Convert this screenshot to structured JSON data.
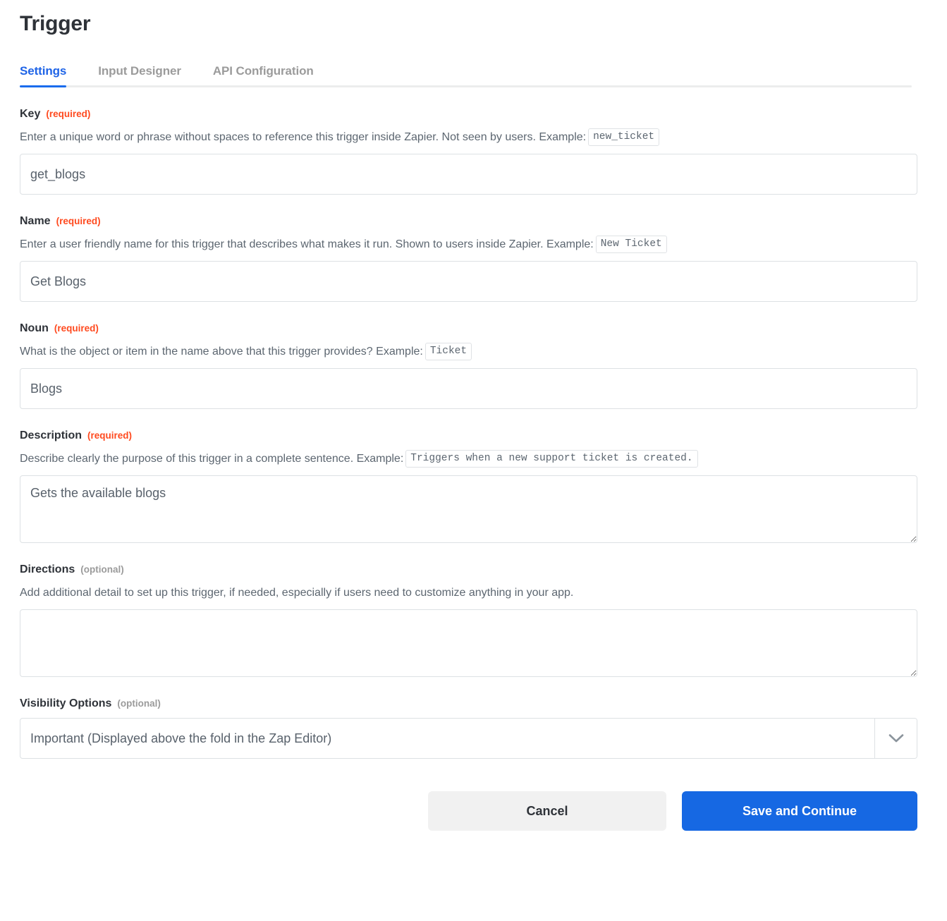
{
  "page": {
    "title": "Trigger"
  },
  "tabs": [
    {
      "label": "Settings",
      "active": true
    },
    {
      "label": "Input Designer",
      "active": false
    },
    {
      "label": "API Configuration",
      "active": false
    }
  ],
  "fields": {
    "key": {
      "label": "Key",
      "requirement": "(required)",
      "help_before": "Enter a unique word or phrase without spaces to reference this trigger inside Zapier. Not seen by users. Example:",
      "example": "new_ticket",
      "value": "get_blogs"
    },
    "name": {
      "label": "Name",
      "requirement": "(required)",
      "help_before": "Enter a user friendly name for this trigger that describes what makes it run. Shown to users inside Zapier. Example:",
      "example": "New Ticket",
      "value": "Get Blogs"
    },
    "noun": {
      "label": "Noun",
      "requirement": "(required)",
      "help_before": "What is the object or item in the name above that this trigger provides? Example:",
      "example": "Ticket",
      "value": "Blogs"
    },
    "description": {
      "label": "Description",
      "requirement": "(required)",
      "help_before": "Describe clearly the purpose of this trigger in a complete sentence. Example:",
      "example": "Triggers when a new support ticket is created.",
      "value": "Gets the available blogs"
    },
    "directions": {
      "label": "Directions",
      "requirement": "(optional)",
      "help_before": "Add additional detail to set up this trigger, if needed, especially if users need to customize anything in your app.",
      "example": "",
      "value": ""
    },
    "visibility": {
      "label": "Visibility Options",
      "requirement": "(optional)",
      "selected": "Important (Displayed above the fold in the Zap Editor)",
      "chevron_icon": "chevron-down-icon"
    }
  },
  "footer": {
    "cancel_label": "Cancel",
    "save_label": "Save and Continue"
  },
  "colors": {
    "accent_blue": "#1668e3",
    "required_orange": "#ff4a1f",
    "optional_gray": "#9b9b9b",
    "border_gray": "#dde1e4"
  }
}
